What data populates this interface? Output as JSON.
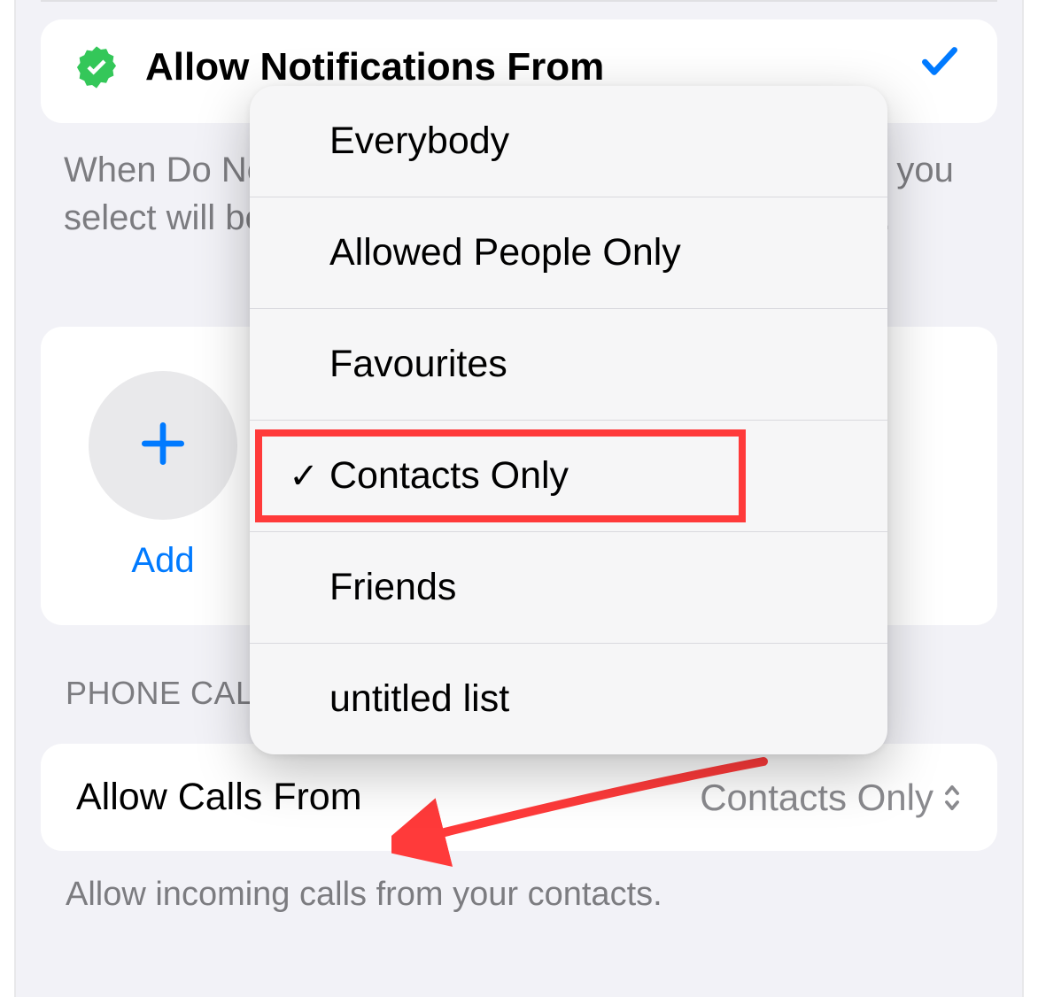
{
  "notifications": {
    "title": "Allow Notifications From",
    "description": "When Do Not Disturb is on, notifications from people you select will be allowed and sent to Notification Centre."
  },
  "add_button": {
    "label": "Add"
  },
  "phone_calls": {
    "header": "PHONE CALLS",
    "row_label": "Allow Calls From",
    "row_value": "Contacts Only",
    "footer": "Allow incoming calls from your contacts."
  },
  "dropdown": {
    "items": [
      {
        "label": "Everybody",
        "checked": false
      },
      {
        "label": "Allowed People Only",
        "checked": false
      },
      {
        "label": "Favourites",
        "checked": false
      },
      {
        "label": "Contacts Only",
        "checked": true
      },
      {
        "label": "Friends",
        "checked": false
      },
      {
        "label": "untitled list",
        "checked": false
      }
    ]
  }
}
